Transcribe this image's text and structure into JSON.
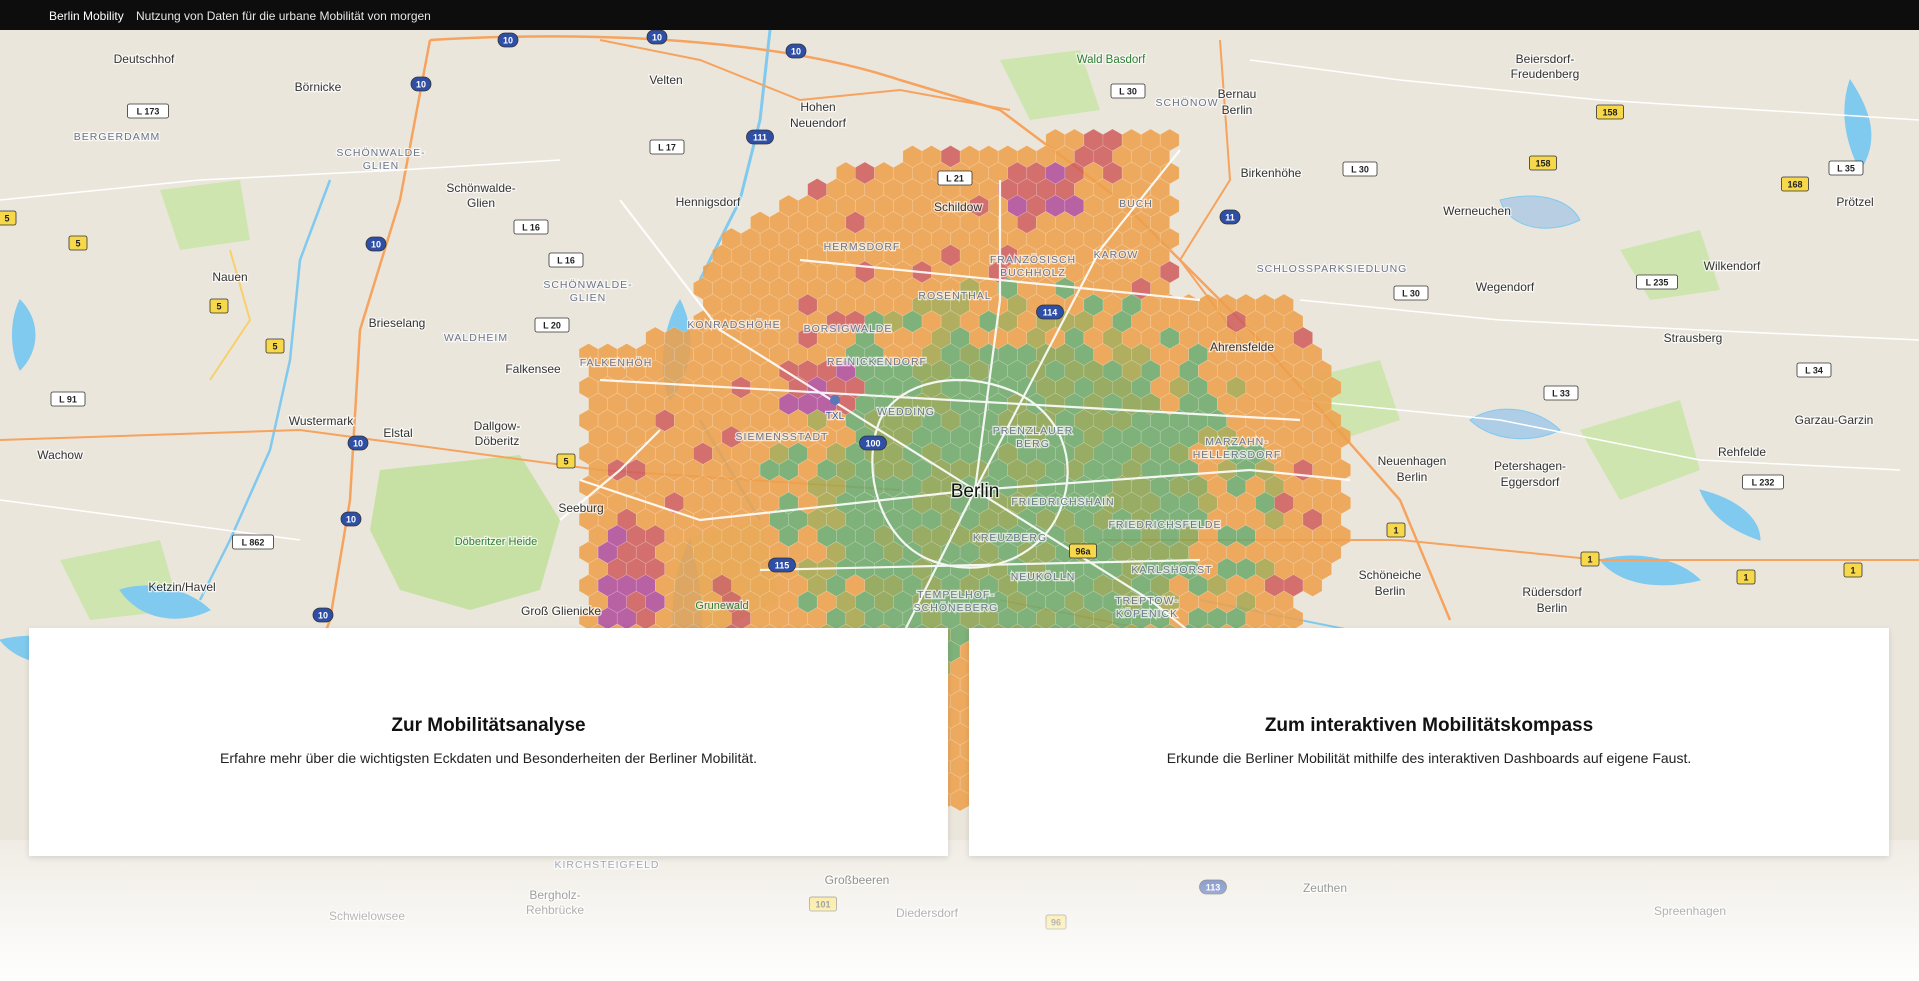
{
  "header": {
    "brand": "Berlin Mobility",
    "tagline": "Nutzung von Daten für die urbane Mobilität von morgen"
  },
  "cards": {
    "analysis": {
      "title": "Zur Mobilitätsanalyse",
      "text": "Erfahre mehr über die wichtigsten Eckdaten und Besonderheiten der Berliner Mobilität."
    },
    "compass": {
      "title": "Zum interaktiven Mobilitätskompass",
      "text": "Erkunde die Berliner Mobilität mithilfe des interaktiven Dashboards auf eigene Faust."
    }
  },
  "map": {
    "places": {
      "berlin": "Berlin",
      "deutschhof": "Deutschhof",
      "boernicke": "Börnicke",
      "velten": "Velten",
      "hohen_neuendorf": "Hohen Neuendorf",
      "hennigsdorf": "Hennigsdorf",
      "schildow": "Schildow",
      "wald_basdorf": "Wald Basdorf",
      "bernau": "Bernau bei Berlin",
      "beiersdorf": "Beiersdorf-Freudenberg",
      "nauen": "Nauen",
      "schoenwalde_glien": "Schönwalde-Glien",
      "brieselang": "Brieselang",
      "falkensee": "Falkensee",
      "wustermark": "Wustermark",
      "elstal": "Elstal",
      "dallgow": "Dallgow-Döberitz",
      "wachow": "Wachow",
      "seeburg": "Seeburg",
      "doeberitzer_heide": "Döberitzer Heide",
      "ketzin": "Ketzin/Havel",
      "gross_glienicke": "Groß Glienicke",
      "grunewald": "Grunewald",
      "ahrensfelde": "Ahrensfelde",
      "birkenhoehe": "Birkenhöhe",
      "werneuchen": "Werneuchen",
      "wegendorf": "Wegendorf",
      "wilkendorf": "Wilkendorf",
      "proetzel": "Prötzel",
      "strausberg": "Strausberg",
      "garzau": "Garzau-Garzin",
      "rehfelde": "Rehfelde",
      "neuenhagen": "Neuenhagen bei Berlin",
      "petershagen": "Petershagen-Eggersdorf",
      "schoeneiche": "Schöneiche bei Berlin",
      "ruedersdorf": "Rüdersdorf bei Berlin",
      "bergholz": "Bergholz-Rehbrücke",
      "grossbeeren": "Großbeeren",
      "diedersdorf": "Diedersdorf",
      "zeuthen": "Zeuthen",
      "spreenhagen": "Spreenhagen",
      "schwielowsee": "Schwielowsee"
    },
    "districts": {
      "bergerdamm": "BERGERDAMM",
      "schoenwalde_glien_1": "SCHÖNWALDE-GLIEN",
      "schoenwalde_glien_2": "SCHÖNWALDE-GLIEN",
      "waldheim": "WALDHEIM",
      "falkenhoeh": "FALKENHÖH",
      "konradshoehe": "KONRADSHÖHE",
      "borsigwalde": "BORSIGWALDE",
      "hermsdorf": "HERMSDORF",
      "rosenthal": "ROSENTHAL",
      "franzoesisch_buchholz": "FRANZÖSISCH BUCHHOLZ",
      "karow": "KAROW",
      "buch": "BUCH",
      "schoenow": "SCHÖNOW",
      "schlossparksiedlung": "SCHLOSSPARKSIEDLUNG",
      "reinickendorf": "REINICKENDORF",
      "wedding": "WEDDING",
      "siemensstadt": "SIEMENSSTADT",
      "prenzlauer_berg": "PRENZLAUER BERG",
      "friedrichshain": "FRIEDRICHSHAIN",
      "kreuzberg": "KREUZBERG",
      "neukoelln": "NEUKÖLLN",
      "friedrichsfelde": "FRIEDRICHSFELDE",
      "karlshorst": "KARLSHORST",
      "tempelhof": "TEMPELHOF-SCHÖNEBERG",
      "treptow": "TREPTOW-KÖPENICK",
      "marzahn": "MARZAHN-HELLERSDORF",
      "kirchsteigfeld": "KIRCHSTEIGFELD",
      "txl": "TXL"
    },
    "shields": {
      "a10_1": "10",
      "a10_2": "10",
      "a10_3": "10",
      "a10_4": "10",
      "a10_5": "10",
      "a10_6": "10",
      "a10_7": "10",
      "a10_8": "10",
      "a11": "11",
      "a111": "111",
      "a100": "100",
      "a114": "114",
      "a115": "115",
      "a113": "113",
      "l173": "L 173",
      "l17": "L 17",
      "l16_1": "L 16",
      "l16_2": "L 16",
      "l20": "L 20",
      "l21": "L 21",
      "l30_1": "L 30",
      "l30_2": "L 30",
      "l30_3": "L 30",
      "l91": "L 91",
      "l862": "L 862",
      "l235": "L 235",
      "l33": "L 33",
      "l34": "L 34",
      "l35": "L 35",
      "l232": "L 232",
      "b5_1": "5",
      "b5_2": "5",
      "b5_3": "5",
      "b5_4": "5",
      "b5_5": "5",
      "b1_1": "1",
      "b1_2": "1",
      "b1_3": "1",
      "b1_4": "1",
      "b158_1": "158",
      "b158_2": "158",
      "b168": "168",
      "b96a": "96a",
      "b101": "101",
      "b96": "96"
    },
    "colors": {
      "land": "#ebe6dc",
      "water": "#7ec8ef",
      "park": "#c9e2a8",
      "motorway": "#f5a05c",
      "hex_orange": "#eea04a",
      "hex_green": "#6da86a",
      "hex_red": "#cf5c5a",
      "hex_purple": "#b04a9a"
    }
  }
}
